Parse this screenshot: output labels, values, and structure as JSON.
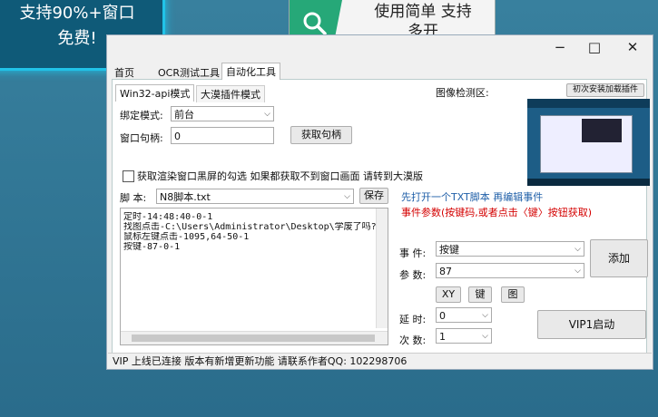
{
  "promo_left": {
    "line1": "支持90%+窗口",
    "line2": "免费!"
  },
  "promo_right": {
    "icon": "search-icon",
    "line1": "使用简单 支持",
    "line2": "多开"
  },
  "window": {
    "min": "−",
    "max": "□",
    "close": "✕"
  },
  "tabs": [
    "首页",
    "OCR测试工具",
    "自动化工具"
  ],
  "subtabs": [
    "Win32-api模式",
    "大漠插件模式"
  ],
  "image_area_label": "图像检测区:",
  "first_load_btn": "初次安装加载插件",
  "bind_mode": {
    "label": "绑定模式:",
    "value": "前台"
  },
  "handle": {
    "label": "窗口句柄:",
    "value": "0",
    "button": "获取句柄"
  },
  "checkbox_text": "获取渲染窗口黑屏的勾选 如果都获取不到窗口画面 请转到大漠版",
  "script": {
    "label": "脚 本:",
    "value": "N8脚本.txt",
    "save": "保存"
  },
  "script_lines": [
    "定时-14:48:40-0-1",
    "找图点击-C:\\Users\\Administrator\\Desktop\\学废了吗?",
    "鼠标左键点击-1095,64-50-1",
    "按键-87-0-1"
  ],
  "hint_blue": "先打开一个TXT脚本 再编辑事件",
  "hint_red": "事件参数(按键码,或者点击〈键〉按钮获取)",
  "event": {
    "label": "事 件:",
    "value": "按键"
  },
  "param": {
    "label": "参 数:",
    "value": "87"
  },
  "add_button": "添加",
  "tool_buttons": [
    "XY",
    "键",
    "图"
  ],
  "delay": {
    "label": "延 时:",
    "value": "0"
  },
  "count": {
    "label": "次 数:",
    "value": "1"
  },
  "start_button": "VIP1启动",
  "status": "VIP 上线已连接   版本有新增更新功能 请联系作者QQ: 102298706"
}
